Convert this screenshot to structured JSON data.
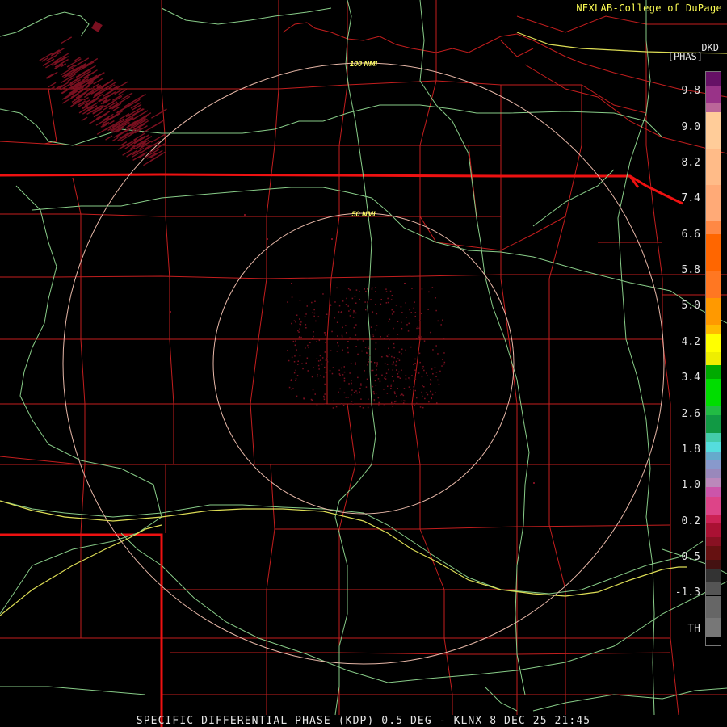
{
  "header": {
    "credit": "NEXLAB-College of DuPage",
    "product_code": "DKD",
    "units": "[PHAS]"
  },
  "range_rings": [
    {
      "label": "100 NMI",
      "radius_nmi": 100
    },
    {
      "label": "50 NMI",
      "radius_nmi": 50
    }
  ],
  "color_scale": {
    "labels": [
      "9.8",
      "9.0",
      "8.2",
      "7.4",
      "6.6",
      "5.8",
      "5.0",
      "4.2",
      "3.4",
      "2.6",
      "1.8",
      "1.0",
      "0.2",
      "-0.5",
      "-1.3",
      "TH"
    ],
    "bands": [
      {
        "from": 10.2,
        "to": 9.9,
        "color": "#661166"
      },
      {
        "from": 9.9,
        "to": 9.5,
        "color": "#993388"
      },
      {
        "from": 9.5,
        "to": 9.3,
        "color": "#bb6699"
      },
      {
        "from": 9.3,
        "to": 8.5,
        "color": "#ffcc99"
      },
      {
        "from": 8.5,
        "to": 7.7,
        "color": "#ffbb88"
      },
      {
        "from": 7.7,
        "to": 6.9,
        "color": "#ffaa77"
      },
      {
        "from": 6.9,
        "to": 6.6,
        "color": "#ff8844"
      },
      {
        "from": 6.6,
        "to": 5.8,
        "color": "#ff6600"
      },
      {
        "from": 5.8,
        "to": 5.2,
        "color": "#ff7722"
      },
      {
        "from": 5.2,
        "to": 4.6,
        "color": "#ff9900"
      },
      {
        "from": 4.6,
        "to": 4.4,
        "color": "#ffbb00"
      },
      {
        "from": 4.4,
        "to": 4.0,
        "color": "#ffff00"
      },
      {
        "from": 4.0,
        "to": 3.7,
        "color": "#eeee00"
      },
      {
        "from": 3.7,
        "to": 3.4,
        "color": "#00aa00"
      },
      {
        "from": 3.4,
        "to": 2.8,
        "color": "#00dd00"
      },
      {
        "from": 2.8,
        "to": 2.6,
        "color": "#22bb44"
      },
      {
        "from": 2.6,
        "to": 2.2,
        "color": "#119944"
      },
      {
        "from": 2.2,
        "to": 2.0,
        "color": "#44ccaa"
      },
      {
        "from": 2.0,
        "to": 1.8,
        "color": "#55dddd"
      },
      {
        "from": 1.8,
        "to": 1.6,
        "color": "#66aacc"
      },
      {
        "from": 1.6,
        "to": 1.4,
        "color": "#8899cc"
      },
      {
        "from": 1.4,
        "to": 1.2,
        "color": "#9988bb"
      },
      {
        "from": 1.2,
        "to": 1.0,
        "color": "#bb88bb"
      },
      {
        "from": 1.0,
        "to": 0.8,
        "color": "#cc55aa"
      },
      {
        "from": 0.8,
        "to": 0.4,
        "color": "#dd4488"
      },
      {
        "from": 0.4,
        "to": 0.2,
        "color": "#cc2255"
      },
      {
        "from": 0.2,
        "to": -0.1,
        "color": "#aa1133"
      },
      {
        "from": -0.1,
        "to": -0.3,
        "color": "#881122"
      },
      {
        "from": -0.3,
        "to": -0.6,
        "color": "#661111"
      },
      {
        "from": -0.6,
        "to": -0.8,
        "color": "#441111"
      },
      {
        "from": -0.8,
        "to": -1.1,
        "color": "#333333"
      },
      {
        "from": -1.1,
        "to": -1.4,
        "color": "#555555"
      },
      {
        "from": -1.4,
        "to": -1.9,
        "color": "#666666"
      },
      {
        "from": -1.9,
        "to": -2.3,
        "color": "#777777"
      },
      {
        "from": -2.3,
        "to": -2.5,
        "color": "#000000"
      }
    ]
  },
  "colors": {
    "county_lines": "#c41e1e",
    "state_lines": "#ee1111",
    "highways": "#88cc88",
    "interstate": "#dddd55",
    "range_rings": "#e8b8a8",
    "ring_labels": "#ffff66",
    "echo": "#7a1020"
  },
  "footer": {
    "title": "SPECIFIC DIFFERENTIAL PHASE (KDP) 0.5 DEG - KLNX 8 DEC 25 21:45"
  }
}
